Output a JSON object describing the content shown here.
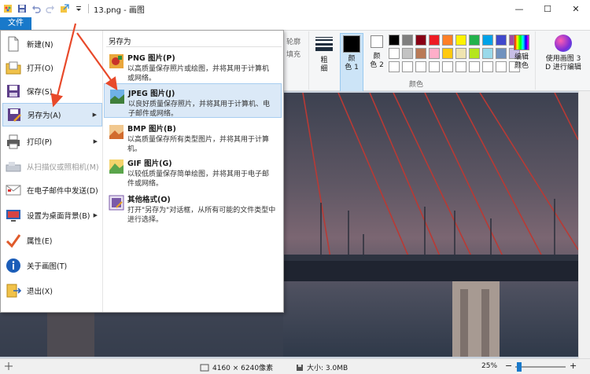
{
  "window": {
    "title": "13.png - 画图",
    "minimize": "—",
    "maximize": "☐",
    "close": "✕"
  },
  "quick_access": [
    "paint-logo-icon",
    "save-icon",
    "undo-icon",
    "redo-icon",
    "export-icon",
    "dropdown-icon"
  ],
  "ribbon": {
    "file_tab": "文件",
    "outline_label": "轮廓",
    "fill_label": "填充",
    "size_label_1": "粗",
    "size_label_2": "细",
    "color1_label_1": "颜",
    "color1_label_2": "色 1",
    "color2_label_1": "颜",
    "color2_label_2": "色 2",
    "palette_label": "颜色",
    "edit_colors_1": "编辑",
    "edit_colors_2": "颜色",
    "paint3d_1": "使用画图 3",
    "paint3d_2": "D 进行编辑",
    "palette": [
      "#000000",
      "#7f7f7f",
      "#880015",
      "#ed1c24",
      "#ff7f27",
      "#fff200",
      "#22b14c",
      "#00a2e8",
      "#3f48cc",
      "#a349a4",
      "#ffffff",
      "#c3c3c3",
      "#b97a57",
      "#ffaec9",
      "#ffc90e",
      "#efe4b0",
      "#b5e61d",
      "#99d9ea",
      "#7092be",
      "#c8bfe7",
      "#ffffff",
      "#ffffff",
      "#ffffff",
      "#ffffff",
      "#ffffff",
      "#ffffff",
      "#ffffff",
      "#ffffff",
      "#ffffff",
      "#ffffff"
    ]
  },
  "file_menu": {
    "items": [
      {
        "label": "新建(N)",
        "icon": "new-file-icon"
      },
      {
        "label": "打开(O)",
        "icon": "open-folder-icon"
      },
      {
        "label": "保存(S)",
        "icon": "save-icon"
      },
      {
        "label": "另存为(A)",
        "icon": "save-as-icon"
      },
      {
        "label": "打印(P)",
        "icon": "print-icon"
      },
      {
        "label": "从扫描仪或照相机(M)",
        "icon": "scanner-icon"
      },
      {
        "label": "在电子邮件中发送(D)",
        "icon": "email-icon"
      },
      {
        "label": "设置为桌面背景(B)",
        "icon": "desktop-background-icon"
      },
      {
        "label": "属性(E)",
        "icon": "properties-icon"
      },
      {
        "label": "关于画图(T)",
        "icon": "info-icon"
      },
      {
        "label": "退出(X)",
        "icon": "exit-icon"
      }
    ],
    "submenu_title": "另存为",
    "save_as": [
      {
        "title": "PNG 图片(P)",
        "desc": "以高质量保存照片或绘图，并将其用于计算机\n或网络。",
        "icon": "png-icon"
      },
      {
        "title": "JPEG 图片(J)",
        "desc": "以良好质量保存照片，并将其用于计算机、电\n子邮件或网络。",
        "icon": "jpeg-icon"
      },
      {
        "title": "BMP 图片(B)",
        "desc": "以高质量保存所有类型图片，并将其用于计算\n机。",
        "icon": "bmp-icon"
      },
      {
        "title": "GIF 图片(G)",
        "desc": "以较低质量保存简单绘图，并将其用于电子邮\n件或网络。",
        "icon": "gif-icon"
      },
      {
        "title": "其他格式(O)",
        "desc": "打开\"另存为\"对话框，从所有可能的文件类型中\n进行选择。",
        "icon": "other-formats-icon"
      }
    ]
  },
  "status": {
    "dimensions": "4160 × 6240像素",
    "size": "大小: 3.0MB",
    "zoom": "25%",
    "zoom_level": 0.25,
    "zoom_out": "−",
    "zoom_in": "+"
  },
  "colors": {
    "accent": "#1979ca",
    "hover": "#dbe9f7",
    "arrow": "#e8492a"
  }
}
